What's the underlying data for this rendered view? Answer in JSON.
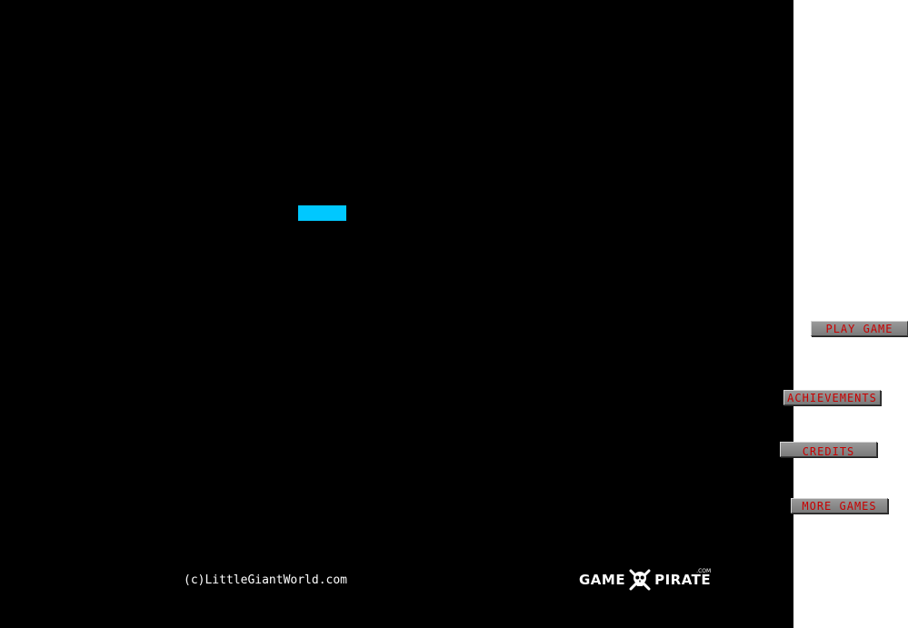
{
  "game": {
    "colors": {
      "stage_bg": "#000000",
      "block": "#00c8ff",
      "button_text": "#c80000",
      "button_face": "#8a8a8a"
    },
    "menu": {
      "play": "PLAY GAME",
      "achievements": "ACHIEVEMENTS",
      "credits": "CREDITS",
      "more_games": "MORE GAMES"
    },
    "copyright": "(c)LittleGiantWorld.com",
    "logo": {
      "left_word": "GAME",
      "right_word": "PIRATE",
      "suffix": ".COM",
      "icon": "skull-crossbones-icon"
    }
  }
}
